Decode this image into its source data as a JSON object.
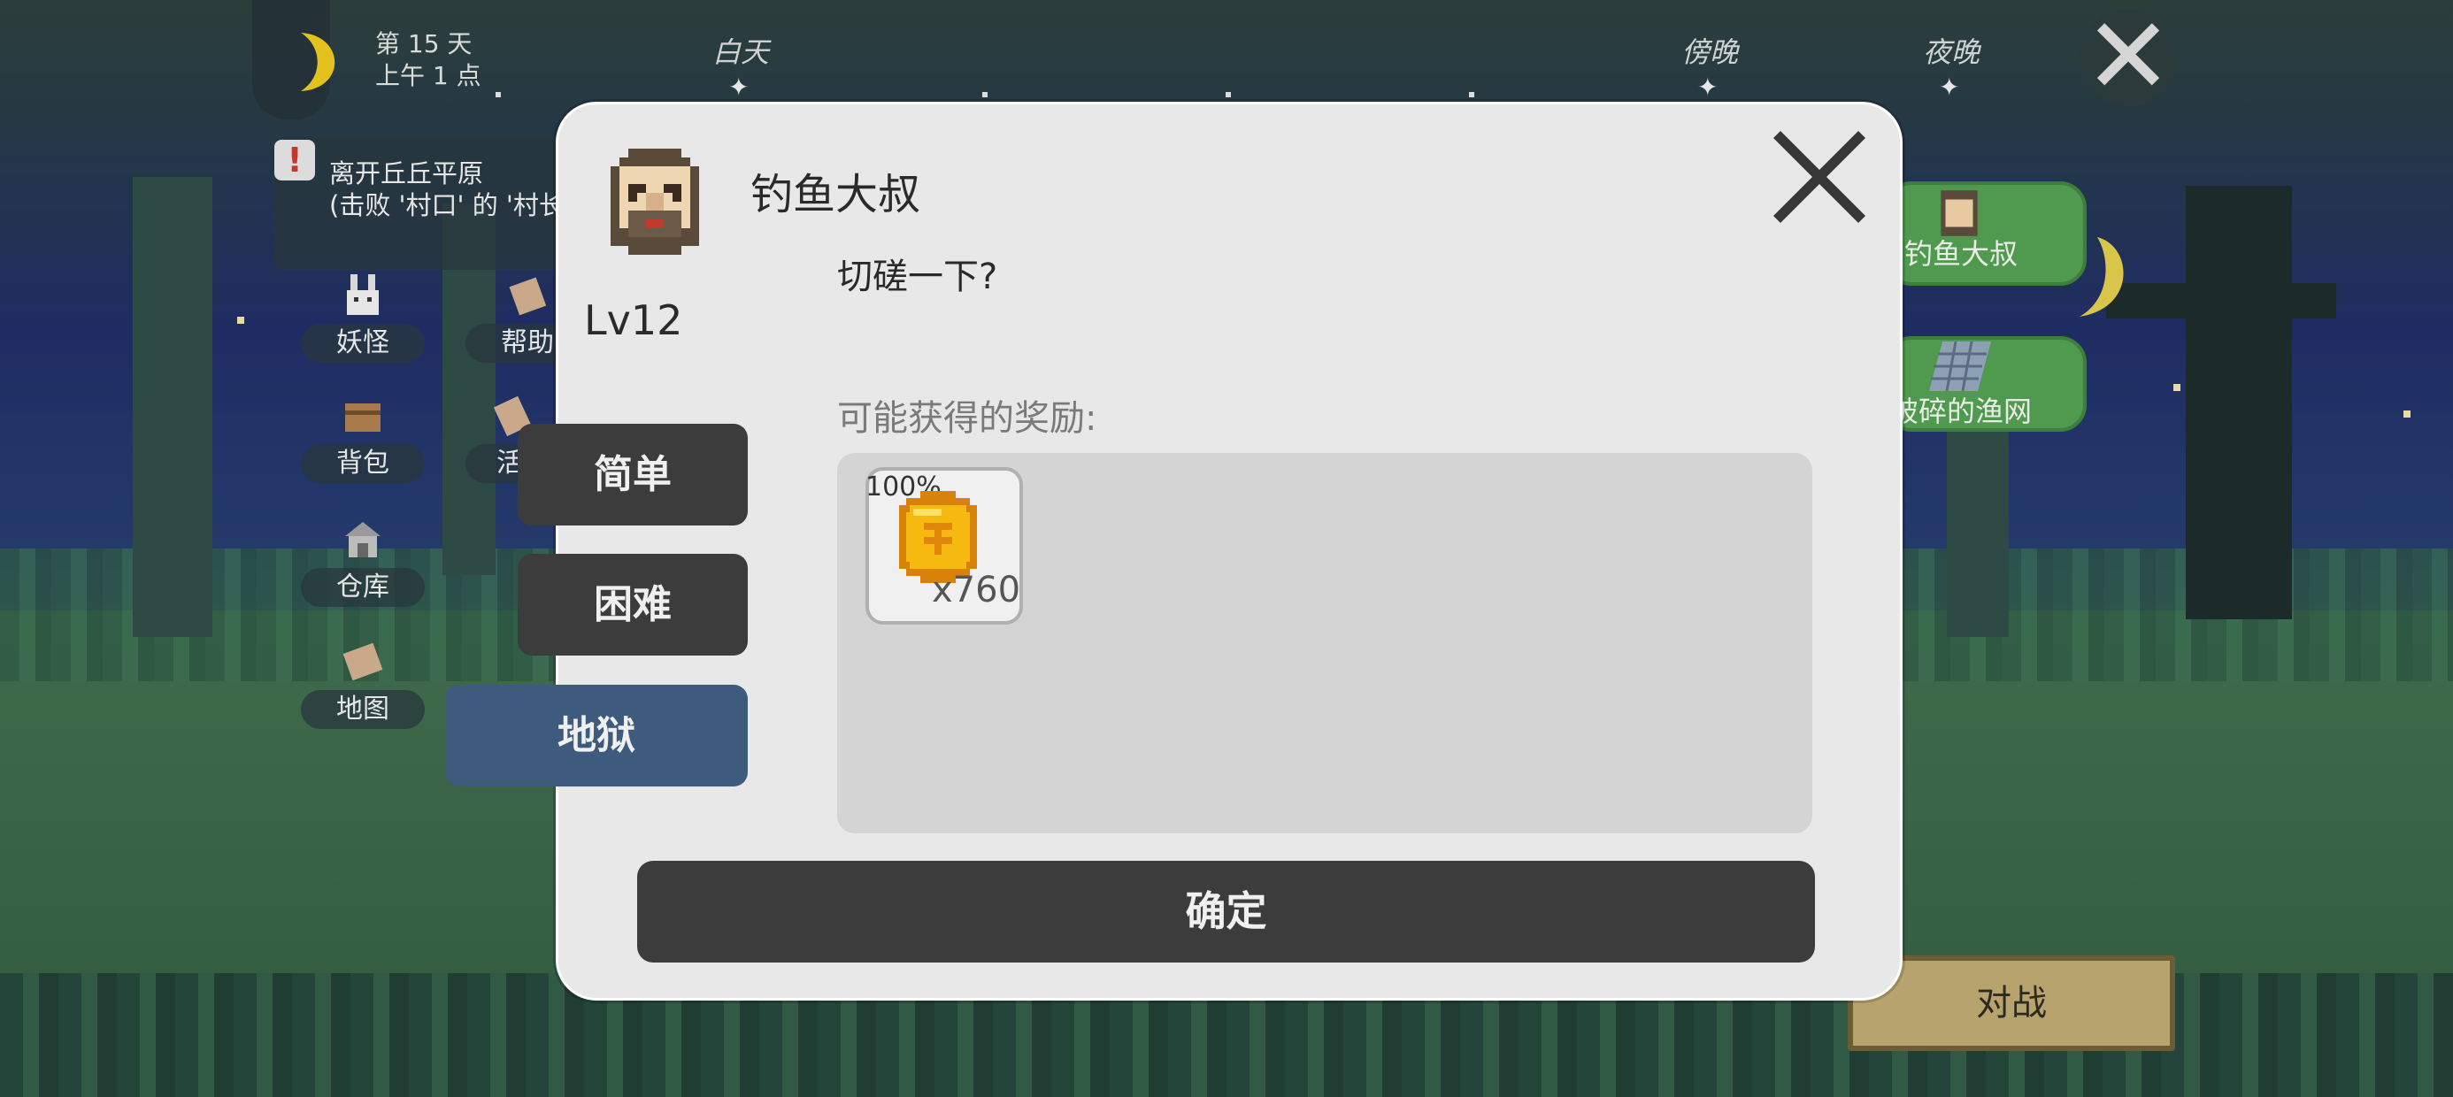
{
  "hud": {
    "day": "第 15 天",
    "time": "上午 1 点",
    "phases": [
      "白天",
      "傍晚",
      "夜晚"
    ]
  },
  "quest": {
    "line1": "离开丘丘平原",
    "line2": "(击败 '村口' 的 '村长"
  },
  "menu": {
    "items": [
      {
        "label": "妖怪",
        "icon": "rabbit-icon"
      },
      {
        "label": "帮助",
        "icon": "scroll-icon"
      },
      {
        "label": "背包",
        "icon": "backpack-icon"
      },
      {
        "label": "活",
        "icon": "activity-icon"
      },
      {
        "label": "仓库",
        "icon": "warehouse-icon"
      },
      {
        "label": "地图",
        "icon": "map-icon"
      }
    ]
  },
  "world": {
    "npc_label": "钓鱼大叔",
    "item_label": "破碎的渔网",
    "battle_label": "对战"
  },
  "dialog": {
    "npc_name": "钓鱼大叔",
    "level": "Lv12",
    "greeting": "切磋一下?",
    "rewards_label": "可能获得的奖励:",
    "reward": {
      "chance": "100%",
      "quantity": "x760",
      "icon": "coin-icon"
    },
    "difficulties": [
      {
        "label": "简单",
        "active": false
      },
      {
        "label": "困难",
        "active": false
      },
      {
        "label": "地狱",
        "active": true
      }
    ],
    "confirm_label": "确定"
  },
  "colors": {
    "dialog_bg": "#e8e8e8",
    "button_dark": "#3c3c3c",
    "button_active": "#3e5a7d",
    "npc_green": "#4f9a4f",
    "battle_gold": "#b6a36e"
  }
}
